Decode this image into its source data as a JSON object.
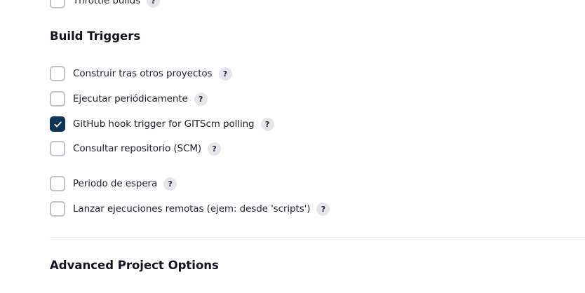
{
  "partial_row": {
    "label": "Throttle builds",
    "help": "?",
    "checked": false
  },
  "build_triggers": {
    "title": "Build Triggers",
    "items": [
      {
        "label": "Construir tras otros proyectos",
        "help": "?",
        "checked": false
      },
      {
        "label": "Ejecutar periódicamente",
        "help": "?",
        "checked": false
      },
      {
        "label": "GitHub hook trigger for GITScm polling",
        "help": "?",
        "checked": true
      },
      {
        "label": "Consultar repositorio (SCM)",
        "help": "?",
        "checked": false
      },
      {
        "label": "Periodo de espera",
        "help": "?",
        "checked": false
      },
      {
        "label": "Lanzar ejecuciones remotas (ejem: desde 'scripts')",
        "help": "?",
        "checked": false
      }
    ]
  },
  "advanced": {
    "title": "Advanced Project Options"
  },
  "colors": {
    "checked_fill": "#0b3559",
    "checkbox_border": "#c2c2cc",
    "help_bg": "#e6e6ea",
    "divider": "#e8e8ec"
  }
}
